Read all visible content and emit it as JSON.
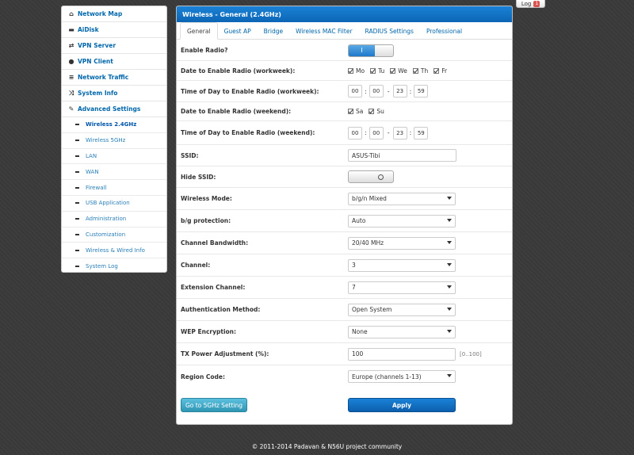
{
  "topbar": {
    "log_label": "Log",
    "log_badge": "1"
  },
  "sidebar": {
    "items": [
      {
        "label": "Network Map",
        "icon": "home-icon"
      },
      {
        "label": "AiDisk",
        "icon": "hdd-icon"
      },
      {
        "label": "VPN Server",
        "icon": "retweet-icon"
      },
      {
        "label": "VPN Client",
        "icon": "globe-icon"
      },
      {
        "label": "Network Traffic",
        "icon": "list-icon"
      },
      {
        "label": "System Info",
        "icon": "random-icon"
      },
      {
        "label": "Advanced Settings",
        "icon": "wrench-icon"
      }
    ],
    "sub_items": [
      "Wireless 2.4GHz",
      "Wireless 5GHz",
      "LAN",
      "WAN",
      "Firewall",
      "USB Application",
      "Administration",
      "Customization",
      "Wireless & Wired Info",
      "System Log"
    ]
  },
  "panel": {
    "title": "Wireless - General (2.4GHz)",
    "tabs": [
      "General",
      "Guest AP",
      "Bridge",
      "Wireless MAC Filter",
      "RADIUS Settings",
      "Professional"
    ]
  },
  "form": {
    "enable_radio_label": "Enable Radio?",
    "enable_radio_on": "I",
    "workweek_label": "Date to Enable Radio (workweek):",
    "workweek_days": [
      "Mo",
      "Tu",
      "We",
      "Th",
      "Fr"
    ],
    "time_workweek_label": "Time of Day to Enable Radio (workweek):",
    "time_workweek": [
      "00",
      "00",
      "23",
      "59"
    ],
    "weekend_label": "Date to Enable Radio (weekend):",
    "weekend_days": [
      "Sa",
      "Su"
    ],
    "time_weekend_label": "Time of Day to Enable Radio (weekend):",
    "time_weekend": [
      "00",
      "00",
      "23",
      "59"
    ],
    "ssid_label": "SSID:",
    "ssid_value": "ASUS-Tibi",
    "hide_ssid_label": "Hide SSID:",
    "wireless_mode_label": "Wireless Mode:",
    "wireless_mode_value": "b/g/n Mixed",
    "bg_protection_label": "b/g protection:",
    "bg_protection_value": "Auto",
    "channel_bw_label": "Channel Bandwidth:",
    "channel_bw_value": "20/40 MHz",
    "channel_label": "Channel:",
    "channel_value": "3",
    "ext_channel_label": "Extension Channel:",
    "ext_channel_value": "7",
    "auth_label": "Authentication Method:",
    "auth_value": "Open System",
    "wep_label": "WEP Encryption:",
    "wep_value": "None",
    "txpower_label": "TX Power Adjustment (%):",
    "txpower_value": "100",
    "txpower_hint": "[0..100]",
    "region_label": "Region Code:",
    "region_value": "Europe (channels 1-13)",
    "goto5g_label": "Go to 5GHz Setting",
    "apply_label": "Apply"
  },
  "footer": {
    "text": "© 2011-2014 Padavan & N56U project community"
  }
}
